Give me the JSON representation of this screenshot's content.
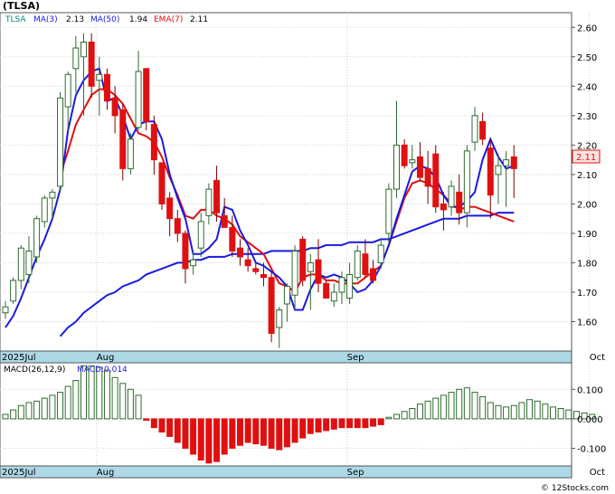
{
  "chart_data": [
    {
      "type": "candlestick",
      "title": "(TLSA)",
      "legend": [
        {
          "label": "TLSA",
          "color": "#00897b"
        },
        {
          "label": "MA(3)",
          "value": "2.13",
          "color": "#1a1ae0"
        },
        {
          "label": "MA(50)",
          "value": "1.94",
          "color": "#1a1ae0"
        },
        {
          "label": "EMA(7)",
          "value": "2.11",
          "color": "#e01010"
        }
      ],
      "last_price_label": "2.11",
      "ylim": [
        1.5,
        2.65
      ],
      "yticks": [
        1.6,
        1.7,
        1.8,
        1.9,
        2.0,
        2.1,
        2.2,
        2.3,
        2.4,
        2.5,
        2.6
      ],
      "ytick_labels": [
        "1.60",
        "1.70",
        "1.80",
        "1.90",
        "2.00",
        "2.10",
        "2.20",
        "2.30",
        "2.40",
        "2.50",
        "2.60"
      ],
      "xaxis_labels": [
        {
          "text": "2025Jul",
          "index": 0
        },
        {
          "text": "Aug",
          "index": 12
        },
        {
          "text": "Sep",
          "index": 44
        },
        {
          "text": "Oct",
          "index": 75
        }
      ],
      "candles": [
        [
          1.63,
          1.67,
          1.61,
          1.65
        ],
        [
          1.67,
          1.75,
          1.66,
          1.74
        ],
        [
          1.74,
          1.86,
          1.71,
          1.85
        ],
        [
          1.76,
          1.89,
          1.73,
          1.84
        ],
        [
          1.82,
          1.96,
          1.8,
          1.95
        ],
        [
          1.94,
          2.03,
          1.92,
          2.02
        ],
        [
          2.02,
          2.05,
          1.95,
          2.04
        ],
        [
          2.06,
          2.38,
          2.04,
          2.36
        ],
        [
          2.33,
          2.45,
          2.25,
          2.44
        ],
        [
          2.46,
          2.57,
          2.38,
          2.53
        ],
        [
          2.5,
          2.58,
          2.3,
          2.55
        ],
        [
          2.55,
          2.58,
          2.36,
          2.4
        ],
        [
          2.42,
          2.5,
          2.3,
          2.44
        ],
        [
          2.44,
          2.46,
          2.32,
          2.35
        ],
        [
          2.36,
          2.4,
          2.24,
          2.3
        ],
        [
          2.32,
          2.34,
          2.08,
          2.12
        ],
        [
          2.12,
          2.24,
          2.1,
          2.22
        ],
        [
          2.26,
          2.52,
          2.25,
          2.45
        ],
        [
          2.46,
          2.46,
          2.25,
          2.28
        ],
        [
          2.27,
          2.3,
          2.1,
          2.15
        ],
        [
          2.14,
          2.14,
          1.98,
          2.0
        ],
        [
          2.02,
          2.04,
          1.89,
          1.95
        ],
        [
          1.95,
          1.98,
          1.87,
          1.9
        ],
        [
          1.9,
          1.91,
          1.73,
          1.78
        ],
        [
          1.79,
          1.84,
          1.76,
          1.81
        ],
        [
          1.85,
          1.97,
          1.82,
          1.94
        ],
        [
          1.96,
          2.07,
          1.93,
          2.05
        ],
        [
          2.08,
          2.13,
          1.94,
          1.97
        ],
        [
          1.96,
          2.02,
          1.92,
          1.92
        ],
        [
          1.92,
          1.96,
          1.82,
          1.84
        ],
        [
          1.85,
          1.88,
          1.79,
          1.82
        ],
        [
          1.81,
          1.85,
          1.77,
          1.79
        ],
        [
          1.78,
          1.8,
          1.76,
          1.77
        ],
        [
          1.76,
          1.8,
          1.72,
          1.75
        ],
        [
          1.75,
          1.77,
          1.53,
          1.56
        ],
        [
          1.58,
          1.65,
          1.51,
          1.64
        ],
        [
          1.66,
          1.73,
          1.6,
          1.72
        ],
        [
          1.69,
          1.86,
          1.64,
          1.84
        ],
        [
          1.88,
          1.89,
          1.72,
          1.74
        ],
        [
          1.77,
          1.83,
          1.64,
          1.8
        ],
        [
          1.81,
          1.88,
          1.7,
          1.73
        ],
        [
          1.73,
          1.74,
          1.68,
          1.68
        ],
        [
          1.67,
          1.73,
          1.65,
          1.7
        ],
        [
          1.7,
          1.77,
          1.66,
          1.75
        ],
        [
          1.68,
          1.8,
          1.66,
          1.76
        ],
        [
          1.75,
          1.86,
          1.74,
          1.84
        ],
        [
          1.83,
          1.88,
          1.75,
          1.76
        ],
        [
          1.78,
          1.81,
          1.73,
          1.74
        ],
        [
          1.8,
          1.88,
          1.78,
          1.86
        ],
        [
          1.9,
          2.07,
          1.87,
          2.05
        ],
        [
          2.05,
          2.35,
          2.02,
          2.2
        ],
        [
          2.2,
          2.22,
          2.12,
          2.13
        ],
        [
          2.14,
          2.2,
          2.12,
          2.15
        ],
        [
          2.16,
          2.21,
          2.08,
          2.09
        ],
        [
          2.12,
          2.18,
          2.0,
          2.06
        ],
        [
          2.17,
          2.2,
          1.97,
          1.99
        ],
        [
          2.0,
          2.04,
          1.91,
          1.98
        ],
        [
          1.99,
          2.08,
          1.96,
          2.06
        ],
        [
          2.04,
          2.1,
          1.93,
          1.97
        ],
        [
          1.97,
          2.2,
          1.92,
          2.18
        ],
        [
          2.21,
          2.33,
          2.18,
          2.3
        ],
        [
          2.28,
          2.31,
          2.2,
          2.22
        ],
        [
          2.19,
          2.22,
          1.95,
          2.03
        ],
        [
          2.1,
          2.17,
          2.0,
          2.13
        ],
        [
          2.13,
          2.18,
          1.99,
          2.15
        ],
        [
          2.16,
          2.2,
          2.02,
          2.12
        ]
      ],
      "ma3": [
        1.58,
        1.62,
        1.68,
        1.75,
        1.82,
        1.88,
        1.95,
        2.05,
        2.25,
        2.37,
        2.42,
        2.45,
        2.46,
        2.35,
        2.36,
        2.3,
        2.22,
        2.27,
        2.28,
        2.28,
        2.22,
        2.1,
        2.02,
        1.95,
        1.83,
        1.83,
        1.85,
        1.88,
        1.99,
        1.98,
        1.91,
        1.86,
        1.8,
        1.79,
        1.77,
        1.75,
        1.72,
        1.64,
        1.64,
        1.71,
        1.76,
        1.75,
        1.76,
        1.75,
        1.73,
        1.7,
        1.71,
        1.74,
        1.79,
        1.86,
        1.95,
        2.03,
        2.11,
        2.13,
        2.12,
        2.09,
        2.03,
        1.99,
        1.99,
        2.01,
        2.04,
        2.15,
        2.22,
        2.16,
        2.12,
        2.13
      ],
      "ema7": [
        null,
        null,
        null,
        null,
        null,
        null,
        null,
        2.1,
        2.18,
        2.27,
        2.32,
        2.37,
        2.39,
        2.39,
        2.37,
        2.34,
        2.29,
        2.24,
        2.23,
        2.21,
        2.16,
        2.09,
        2.03,
        1.96,
        1.95,
        1.98,
        1.98,
        1.96,
        1.95,
        1.93,
        1.89,
        1.87,
        1.85,
        1.83,
        1.78,
        1.73,
        1.72,
        1.7,
        1.75,
        1.76,
        1.76,
        1.74,
        1.74,
        1.73,
        1.73,
        1.73,
        1.75,
        1.77,
        1.79,
        1.86,
        1.94,
        2.02,
        2.07,
        2.08,
        2.07,
        2.05,
        2.03,
        2.0,
        1.98,
        1.99,
        1.99,
        1.98,
        1.97,
        1.96,
        1.95,
        1.94
      ],
      "ma50": [
        null,
        null,
        null,
        null,
        null,
        null,
        null,
        1.55,
        1.58,
        1.6,
        1.63,
        1.65,
        1.67,
        1.69,
        1.7,
        1.72,
        1.73,
        1.74,
        1.76,
        1.77,
        1.78,
        1.79,
        1.8,
        1.8,
        1.81,
        1.81,
        1.82,
        1.82,
        1.82,
        1.83,
        1.83,
        1.83,
        1.83,
        1.83,
        1.84,
        1.84,
        1.84,
        1.84,
        1.84,
        1.85,
        1.85,
        1.86,
        1.86,
        1.86,
        1.87,
        1.87,
        1.87,
        1.87,
        1.88,
        1.88,
        1.89,
        1.9,
        1.91,
        1.92,
        1.93,
        1.94,
        1.95,
        1.95,
        1.95,
        1.96,
        1.96,
        1.96,
        1.96,
        1.97,
        1.97,
        1.97
      ]
    },
    {
      "type": "bar",
      "title": "MACD(26,12,9)",
      "legend_label": "MACD:0.014",
      "ylim": [
        -0.16,
        0.19
      ],
      "yticks": [
        0.1,
        0.0,
        -0.1
      ],
      "ytick_labels": [
        "0.100",
        "0.000",
        "-0.100"
      ],
      "values": [
        0.015,
        0.03,
        0.045,
        0.055,
        0.06,
        0.07,
        0.08,
        0.09,
        0.11,
        0.13,
        0.18,
        0.18,
        0.175,
        0.165,
        0.14,
        0.12,
        0.1,
        0.08,
        -0.005,
        -0.03,
        -0.045,
        -0.06,
        -0.08,
        -0.1,
        -0.12,
        -0.14,
        -0.15,
        -0.145,
        -0.12,
        -0.1,
        -0.09,
        -0.08,
        -0.085,
        -0.09,
        -0.1,
        -0.105,
        -0.095,
        -0.08,
        -0.065,
        -0.05,
        -0.045,
        -0.04,
        -0.035,
        -0.03,
        -0.03,
        -0.03,
        -0.03,
        -0.025,
        -0.02,
        0.005,
        0.015,
        0.025,
        0.035,
        0.05,
        0.06,
        0.07,
        0.08,
        0.09,
        0.1,
        0.105,
        0.09,
        0.075,
        0.055,
        0.045,
        0.04,
        0.045,
        0.055,
        0.065,
        0.06,
        0.05,
        0.04,
        0.035,
        0.03,
        0.025,
        0.02,
        0.015
      ]
    }
  ],
  "watermark": "© 12Stocks.com"
}
